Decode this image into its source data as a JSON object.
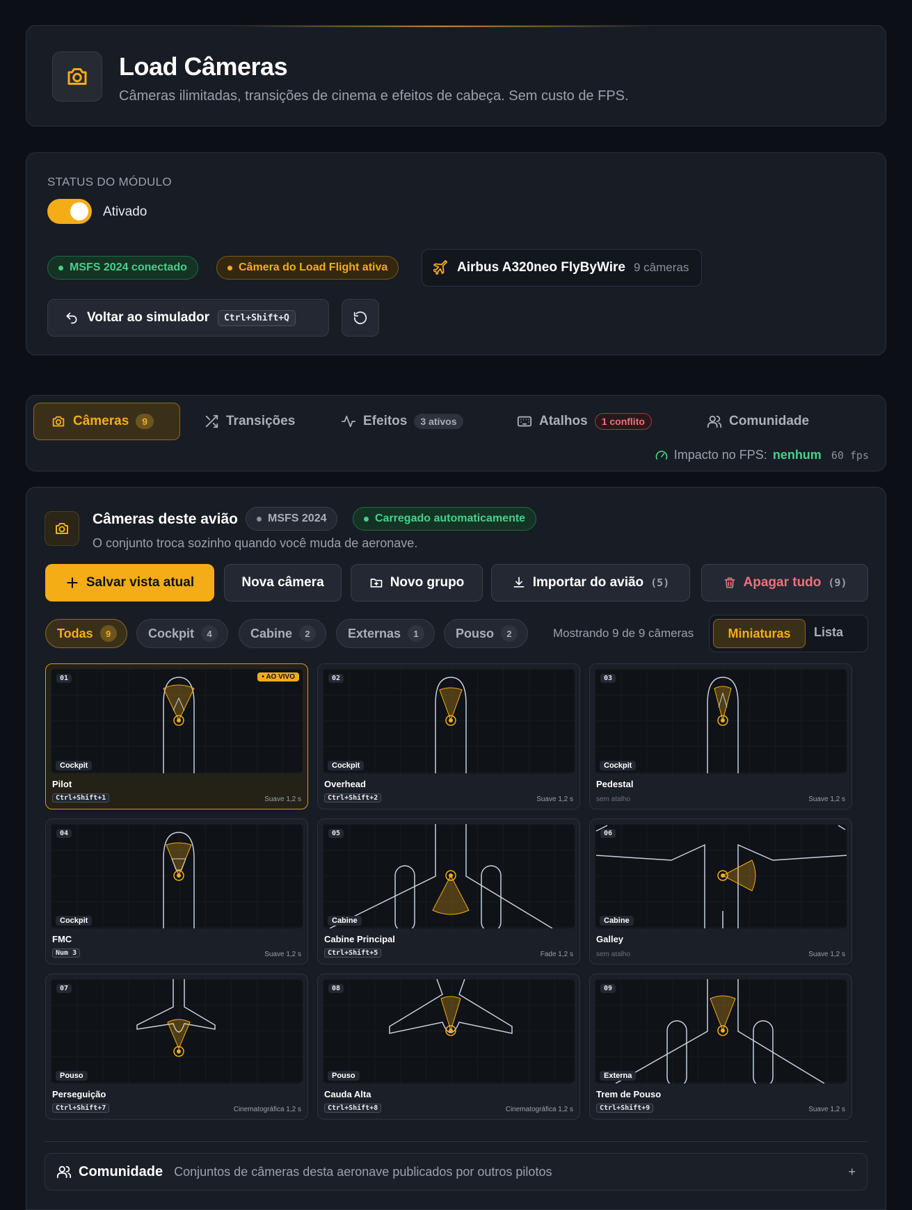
{
  "header": {
    "title": "Load Câmeras",
    "subtitle": "Câmeras ilimitadas, transições de cinema e efeitos de cabeça. Sem custo de FPS."
  },
  "status": {
    "label": "STATUS DO MÓDULO",
    "toggle_label": "Ativado",
    "toggle_on": true,
    "pill_connected": "MSFS 2024 conectado",
    "pill_camera": "Câmera do Load Flight ativa",
    "aircraft_name": "Airbus A320neo FlyByWire",
    "aircraft_count": "9 câmeras",
    "back_label": "Voltar ao simulador",
    "back_shortcut": "Ctrl+Shift+Q"
  },
  "tabs": {
    "cameras": "Câmeras",
    "cameras_count": "9",
    "transitions": "Transições",
    "effects": "Efeitos",
    "effects_badge": "3 ativos",
    "shortcuts": "Atalhos",
    "shortcuts_badge": "1 conflito",
    "community": "Comunidade",
    "fps_label": "Impacto no FPS:",
    "fps_value": "nenhum",
    "fps_num": "60 fps"
  },
  "panel": {
    "title": "Câmeras deste avião",
    "pill_sim": "MSFS 2024",
    "pill_auto": "Carregado automaticamente",
    "subtitle": "O conjunto troca sozinho quando você muda de aeronave.",
    "save_view": "Salvar vista atual",
    "new_camera": "Nova câmera",
    "new_group": "Novo grupo",
    "import_label": "Importar do avião",
    "import_count": "(5)",
    "delete_label": "Apagar tudo",
    "delete_count": "(9)",
    "filters": [
      {
        "label": "Todas",
        "count": "9"
      },
      {
        "label": "Cockpit",
        "count": "4"
      },
      {
        "label": "Cabine",
        "count": "2"
      },
      {
        "label": "Externas",
        "count": "1"
      },
      {
        "label": "Pouso",
        "count": "2"
      }
    ],
    "showing": "Mostrando 9 de 9 câmeras",
    "view_thumbs": "Miniaturas",
    "view_list": "Lista",
    "live_badge": "• AO VIVO",
    "cameras": [
      {
        "num": "01",
        "tag": "Cockpit",
        "name": "Pilot",
        "key": "Ctrl+Shift+1",
        "trans": "Suave 1,2 s"
      },
      {
        "num": "02",
        "tag": "Cockpit",
        "name": "Overhead",
        "key": "Ctrl+Shift+2",
        "trans": "Suave 1,2 s"
      },
      {
        "num": "03",
        "tag": "Cockpit",
        "name": "Pedestal",
        "key": "sem atalho",
        "trans": "Suave 1,2 s"
      },
      {
        "num": "04",
        "tag": "Cockpit",
        "name": "FMC",
        "key": "Num 3",
        "trans": "Suave 1,2 s"
      },
      {
        "num": "05",
        "tag": "Cabine",
        "name": "Cabine Principal",
        "key": "Ctrl+Shift+5",
        "trans": "Fade 1,2 s"
      },
      {
        "num": "06",
        "tag": "Cabine",
        "name": "Galley",
        "key": "sem atalho",
        "trans": "Suave 1,2 s"
      },
      {
        "num": "07",
        "tag": "Pouso",
        "name": "Perseguição",
        "key": "Ctrl+Shift+7",
        "trans": "Cinematográfica 1,2 s"
      },
      {
        "num": "08",
        "tag": "Pouso",
        "name": "Cauda Alta",
        "key": "Ctrl+Shift+8",
        "trans": "Cinematográfica 1,2 s"
      },
      {
        "num": "09",
        "tag": "Externa",
        "name": "Trem de Pouso",
        "key": "Ctrl+Shift+9",
        "trans": "Suave 1,2 s"
      }
    ],
    "community_title": "Comunidade",
    "community_desc": "Conjuntos de câmeras desta aeronave publicados por outros pilotos",
    "community_expand": "+"
  },
  "colors": {
    "accent": "#f5ad17",
    "success": "#45d18a",
    "danger": "#f0707b",
    "background": "#0c0f15",
    "card": "#181c24"
  }
}
